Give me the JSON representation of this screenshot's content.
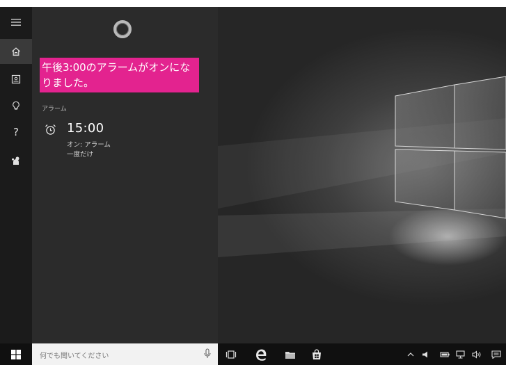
{
  "nav": {
    "items": [
      {
        "icon": "hamburger-icon"
      },
      {
        "icon": "home-icon",
        "active": true
      },
      {
        "icon": "notebook-icon"
      },
      {
        "icon": "lightbulb-icon"
      },
      {
        "icon": "help-icon",
        "glyph": "?"
      },
      {
        "icon": "feedback-icon"
      }
    ]
  },
  "cortana": {
    "notification": "午後3:00のアラームがオンになりました。",
    "notification_color": "#e3238f",
    "section_label": "アラーム",
    "alarm": {
      "time": "15:00",
      "status": "オン: アラーム",
      "repeat": "一度だけ"
    }
  },
  "taskbar": {
    "search_placeholder": "何でも聞いてください",
    "apps": [
      "task-view-icon",
      "edge-icon",
      "file-explorer-icon",
      "store-icon"
    ],
    "tray": [
      "chevron-up-icon",
      "volume-icon",
      "battery-icon",
      "network-icon",
      "speaker-icon",
      "action-center-icon"
    ]
  },
  "colors": {
    "panel_bg": "#2b2b2b",
    "rail_bg": "#1b1b1b",
    "taskbar_bg": "#101010",
    "accent": "#e3238f"
  }
}
